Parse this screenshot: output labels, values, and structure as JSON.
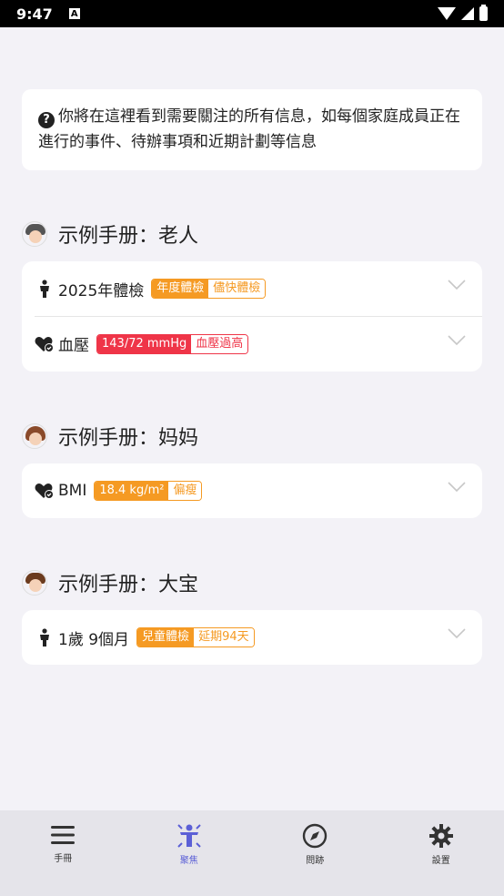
{
  "status": {
    "time": "9:47",
    "a_badge": "A"
  },
  "info": {
    "text": "你將在這裡看到需要關注的所有信息，如每個家庭成員正在進行的事件、待辦事項和近期計劃等信息"
  },
  "sections": [
    {
      "title": "示例手册：老人",
      "rows": [
        {
          "icon": "person-icon",
          "label": "2025年體檢",
          "tag_color": "orange",
          "tag_a": "年度體檢",
          "tag_b": "儘快體檢"
        },
        {
          "icon": "heart-check-icon",
          "label": "血壓",
          "tag_color": "red",
          "tag_a": "143/72 mmHg",
          "tag_b": "血壓過高"
        }
      ]
    },
    {
      "title": "示例手册：妈妈",
      "rows": [
        {
          "icon": "heart-check-icon",
          "label": "BMI",
          "tag_color": "orange",
          "tag_a": "18.4 kg/m²",
          "tag_b": "偏瘦"
        }
      ]
    },
    {
      "title": "示例手册：大宝",
      "rows": [
        {
          "icon": "person-icon",
          "label": "1歲 9個月",
          "tag_color": "orange",
          "tag_a": "兒童體檢",
          "tag_b": "延期94天"
        }
      ]
    }
  ],
  "tabs": [
    {
      "label": "手冊",
      "icon": "menu-icon",
      "active": false
    },
    {
      "label": "聚焦",
      "icon": "focus-icon",
      "active": true
    },
    {
      "label": "問跡",
      "icon": "compass-icon",
      "active": false
    },
    {
      "label": "設置",
      "icon": "gear-icon",
      "active": false
    }
  ],
  "colors": {
    "accent": "#5b5fd6",
    "orange": "#f59a23",
    "red": "#ef3548",
    "background": "#f3f2f7"
  }
}
